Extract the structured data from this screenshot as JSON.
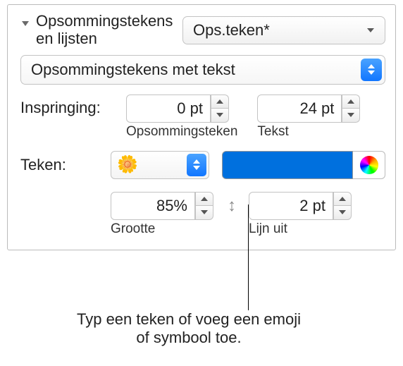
{
  "header": {
    "title": "Opsommings­tekens en lijsten",
    "style_label": "Ops.teken*"
  },
  "type_select": "Opsommingstekens met tekst",
  "indent": {
    "label": "Inspringing:",
    "bullet": {
      "value": "0 pt",
      "caption": "Opsommingsteken"
    },
    "text": {
      "value": "24 pt",
      "caption": "Tekst"
    }
  },
  "character": {
    "label": "Teken:",
    "emoji": "🌼"
  },
  "size": {
    "value": "85%",
    "caption": "Grootte"
  },
  "align": {
    "value": "2 pt",
    "caption": "Lijn uit"
  },
  "callout": "Typ een teken of voeg een emoji of symbool toe."
}
